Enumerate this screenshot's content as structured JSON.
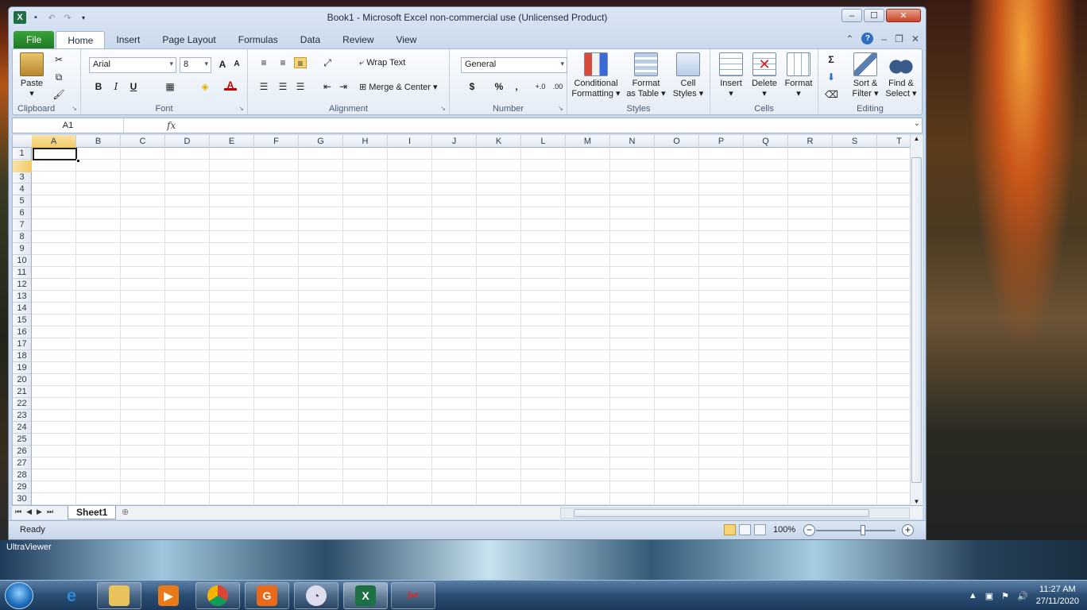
{
  "window": {
    "title": "Book1  -  Microsoft Excel non-commercial use (Unlicensed Product)"
  },
  "tabs": [
    "File",
    "Home",
    "Insert",
    "Page Layout",
    "Formulas",
    "Data",
    "Review",
    "View"
  ],
  "ribbon": {
    "clipboard": {
      "label": "Clipboard",
      "paste": "Paste"
    },
    "font": {
      "label": "Font",
      "name": "Arial",
      "size": "8",
      "bold": "B",
      "italic": "I",
      "underline": "U"
    },
    "alignment": {
      "label": "Alignment",
      "wrap": "Wrap Text",
      "merge": "Merge & Center"
    },
    "number": {
      "label": "Number",
      "format": "General",
      "currency": "$",
      "percent": "%",
      "comma": ","
    },
    "styles": {
      "label": "Styles",
      "cond1": "Conditional",
      "cond2": "Formatting",
      "fmt1": "Format",
      "fmt2": "as Table",
      "cell1": "Cell",
      "cell2": "Styles"
    },
    "cells": {
      "label": "Cells",
      "insert": "Insert",
      "delete": "Delete",
      "format": "Format"
    },
    "editing": {
      "label": "Editing",
      "sort1": "Sort &",
      "sort2": "Filter",
      "find1": "Find &",
      "find2": "Select",
      "sum": "Σ"
    }
  },
  "formula_bar": {
    "name_box": "A1",
    "fx": "fx",
    "value": ""
  },
  "columns": [
    "A",
    "B",
    "C",
    "D",
    "E",
    "F",
    "G",
    "H",
    "I",
    "J",
    "K",
    "L",
    "M",
    "N",
    "O",
    "P",
    "Q",
    "R",
    "S",
    "T"
  ],
  "rows": [
    "1",
    "2",
    "3",
    "4",
    "5",
    "6",
    "7",
    "8",
    "9",
    "10",
    "11",
    "12",
    "13",
    "14",
    "15",
    "16",
    "17",
    "18",
    "19",
    "20",
    "21",
    "22",
    "23",
    "24",
    "25",
    "26",
    "27",
    "28",
    "29",
    "30"
  ],
  "sheets": [
    "Sheet1"
  ],
  "status": {
    "ready": "Ready",
    "zoom": "100%"
  },
  "desktop": {
    "label": "UltraViewer"
  },
  "taskbar": {
    "time": "11:27 AM",
    "date": "27/11/2020"
  }
}
